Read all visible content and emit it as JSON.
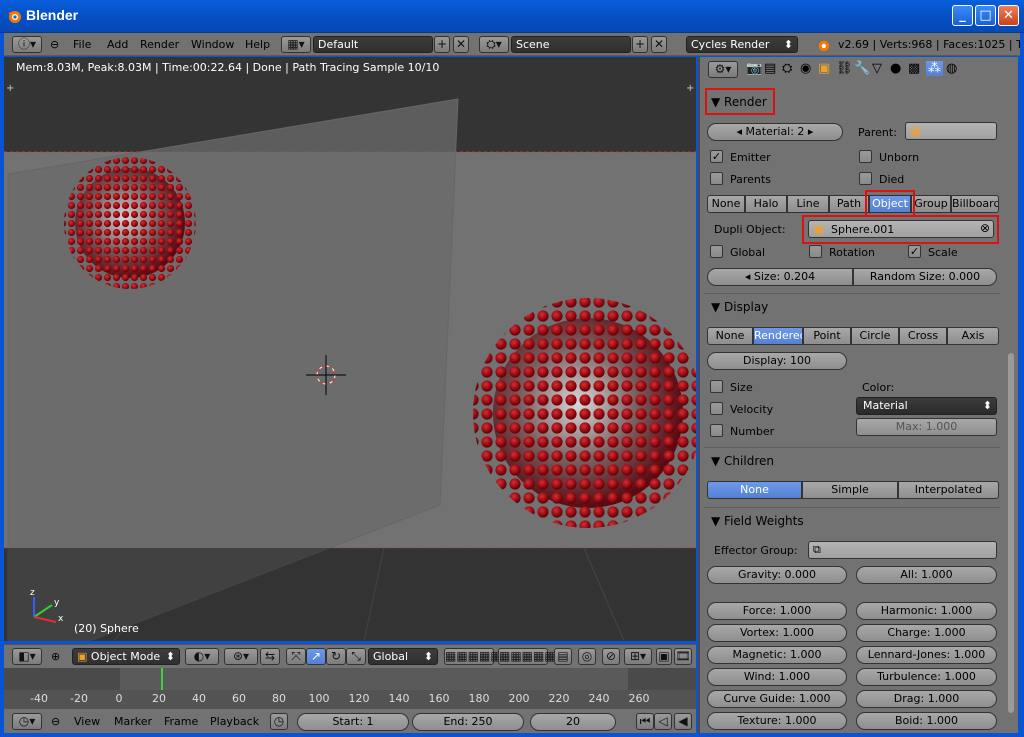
{
  "window": {
    "title": "Blender",
    "min": "_",
    "max": "□",
    "close": "✕"
  },
  "topbar": {
    "menus": [
      "File",
      "Add",
      "Render",
      "Window",
      "Help"
    ],
    "screen_layout": "Default",
    "scene": "Scene",
    "render_engine": "Cycles Render",
    "stats": "v2.69 | Verts:968 | Faces:1025 | Tri"
  },
  "viewport": {
    "info": "Mem:8.03M, Peak:8.03M | Time:00:22.64 | Done | Path Tracing Sample 10/10",
    "object_label": "(20) Sphere",
    "mode": "Object Mode",
    "orientation": "Global",
    "axis_y": "y",
    "axis_x": "x",
    "axis_z": "z"
  },
  "timeline": {
    "ticks": [
      "-40",
      "-20",
      "0",
      "20",
      "40",
      "60",
      "80",
      "100",
      "120",
      "140",
      "160",
      "180",
      "200",
      "220",
      "240",
      "260"
    ],
    "menus": [
      "View",
      "Marker",
      "Frame",
      "Playback"
    ],
    "start": "Start: 1",
    "end": "End: 250",
    "current": "20",
    "current_frame_value": 20
  },
  "props": {
    "render": {
      "header": "Render",
      "material": "Material: 2",
      "parent_label": "Parent:",
      "emitter": "Emitter",
      "unborn": "Unborn",
      "parents": "Parents",
      "died": "Died",
      "types": [
        "None",
        "Halo",
        "Line",
        "Path",
        "Object",
        "Group",
        "Billboard"
      ],
      "selected_type": "Object",
      "dupli_label": "Dupli Object:",
      "dupli_value": "Sphere.001",
      "global": "Global",
      "rotation": "Rotation",
      "scale": "Scale",
      "size": "Size: 0.204",
      "random_size": "Random Size: 0.000"
    },
    "display": {
      "header": "Display",
      "modes": [
        "None",
        "Rendered",
        "Point",
        "Circle",
        "Cross",
        "Axis"
      ],
      "selected": "Rendered",
      "display": "Display: 100",
      "size": "Size",
      "velocity": "Velocity",
      "number": "Number",
      "color_label": "Color:",
      "color_value": "Material",
      "max": "Max: 1.000"
    },
    "children": {
      "header": "Children",
      "modes": [
        "None",
        "Simple",
        "Interpolated"
      ],
      "selected": "None"
    },
    "field_weights": {
      "header": "Field Weights",
      "effector_label": "Effector Group:",
      "gravity": "Gravity: 0.000",
      "all": "All: 1.000",
      "left": [
        "Force: 1.000",
        "Vortex: 1.000",
        "Magnetic: 1.000",
        "Wind: 1.000",
        "Curve Guide: 1.000",
        "Texture: 1.000"
      ],
      "right": [
        "Harmonic: 1.000",
        "Charge: 1.000",
        "Lennard-Jones: 1.000",
        "Turbulence: 1.000",
        "Drag: 1.000",
        "Boid: 1.000"
      ]
    }
  }
}
